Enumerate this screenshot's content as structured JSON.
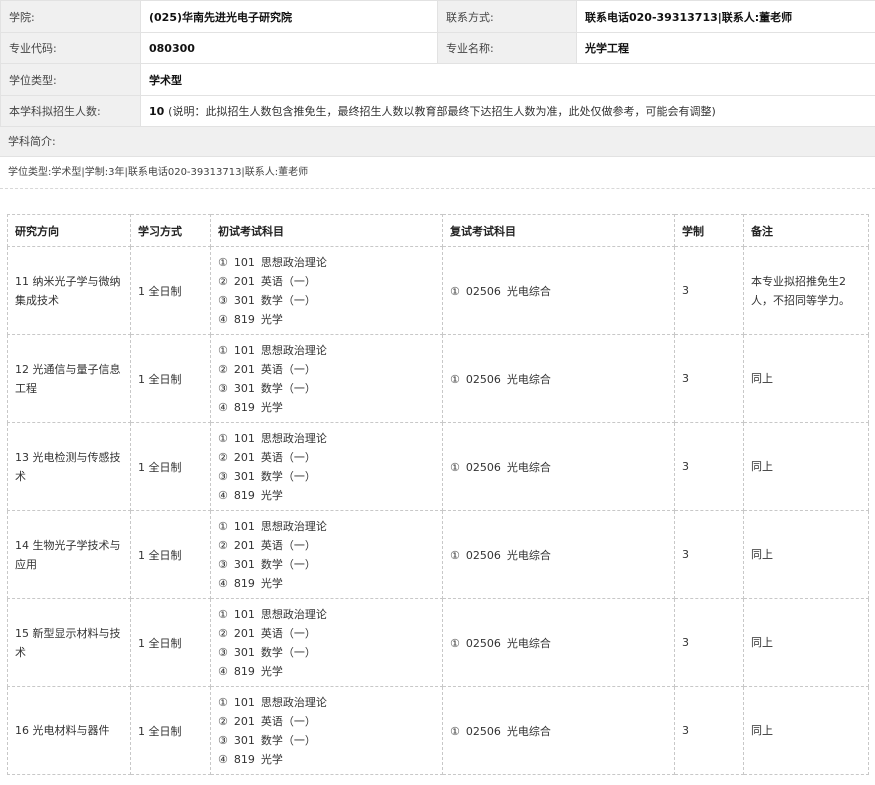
{
  "info": {
    "college_label": "学院:",
    "college_value": "(025)华南先进光电子研究院",
    "contact_label": "联系方式:",
    "contact_value": "联系电话020-39313713|联系人:董老师",
    "major_code_label": "专业代码:",
    "major_code_value": "080300",
    "major_name_label": "专业名称:",
    "major_name_value": "光学工程",
    "degree_type_label": "学位类型:",
    "degree_type_value": "学术型",
    "enroll_label": "本学科拟招生人数:",
    "enroll_value": "10",
    "enroll_note": "(说明：此拟招生人数包含推免生，最终招生人数以教育部最终下达招生人数为准，此处仅做参考，可能会有调整)"
  },
  "intro": {
    "label": "学科简介:",
    "text": "学位类型:学术型|学制:3年|联系电话020-39313713|联系人:董老师"
  },
  "table": {
    "headers": [
      "研究方向",
      "学习方式",
      "初试考试科目",
      "复试考试科目",
      "学制",
      "备注"
    ],
    "rows": [
      {
        "direction": "11 纳米光子学与微纳集成技术",
        "mode": "1 全日制",
        "exam": [
          {
            "num": "①",
            "code": "101",
            "name": "思想政治理论"
          },
          {
            "num": "②",
            "code": "201",
            "name": "英语（一）"
          },
          {
            "num": "③",
            "code": "301",
            "name": "数学（一）"
          },
          {
            "num": "④",
            "code": "819",
            "name": "光学"
          }
        ],
        "retest": {
          "num": "①",
          "code": "02506",
          "name": "光电综合"
        },
        "years": "3",
        "remark": "本专业拟招推免生2人，不招同等学力。"
      },
      {
        "direction": "12 光通信与量子信息工程",
        "mode": "1 全日制",
        "exam": [
          {
            "num": "①",
            "code": "101",
            "name": "思想政治理论"
          },
          {
            "num": "②",
            "code": "201",
            "name": "英语（一）"
          },
          {
            "num": "③",
            "code": "301",
            "name": "数学（一）"
          },
          {
            "num": "④",
            "code": "819",
            "name": "光学"
          }
        ],
        "retest": {
          "num": "①",
          "code": "02506",
          "name": "光电综合"
        },
        "years": "3",
        "remark": "同上"
      },
      {
        "direction": "13 光电检测与传感技术",
        "mode": "1 全日制",
        "exam": [
          {
            "num": "①",
            "code": "101",
            "name": "思想政治理论"
          },
          {
            "num": "②",
            "code": "201",
            "name": "英语（一）"
          },
          {
            "num": "③",
            "code": "301",
            "name": "数学（一）"
          },
          {
            "num": "④",
            "code": "819",
            "name": "光学"
          }
        ],
        "retest": {
          "num": "①",
          "code": "02506",
          "name": "光电综合"
        },
        "years": "3",
        "remark": "同上"
      },
      {
        "direction": "14 生物光子学技术与应用",
        "mode": "1 全日制",
        "exam": [
          {
            "num": "①",
            "code": "101",
            "name": "思想政治理论"
          },
          {
            "num": "②",
            "code": "201",
            "name": "英语（一）"
          },
          {
            "num": "③",
            "code": "301",
            "name": "数学（一）"
          },
          {
            "num": "④",
            "code": "819",
            "name": "光学"
          }
        ],
        "retest": {
          "num": "①",
          "code": "02506",
          "name": "光电综合"
        },
        "years": "3",
        "remark": "同上"
      },
      {
        "direction": "15 新型显示材料与技术",
        "mode": "1 全日制",
        "exam": [
          {
            "num": "①",
            "code": "101",
            "name": "思想政治理论"
          },
          {
            "num": "②",
            "code": "201",
            "name": "英语（一）"
          },
          {
            "num": "③",
            "code": "301",
            "name": "数学（一）"
          },
          {
            "num": "④",
            "code": "819",
            "name": "光学"
          }
        ],
        "retest": {
          "num": "①",
          "code": "02506",
          "name": "光电综合"
        },
        "years": "3",
        "remark": "同上"
      },
      {
        "direction": "16 光电材料与器件",
        "mode": "1 全日制",
        "exam": [
          {
            "num": "①",
            "code": "101",
            "name": "思想政治理论"
          },
          {
            "num": "②",
            "code": "201",
            "name": "英语（一）"
          },
          {
            "num": "③",
            "code": "301",
            "name": "数学（一）"
          },
          {
            "num": "④",
            "code": "819",
            "name": "光学"
          }
        ],
        "retest": {
          "num": "①",
          "code": "02506",
          "name": "光电综合"
        },
        "years": "3",
        "remark": "同上"
      }
    ]
  }
}
